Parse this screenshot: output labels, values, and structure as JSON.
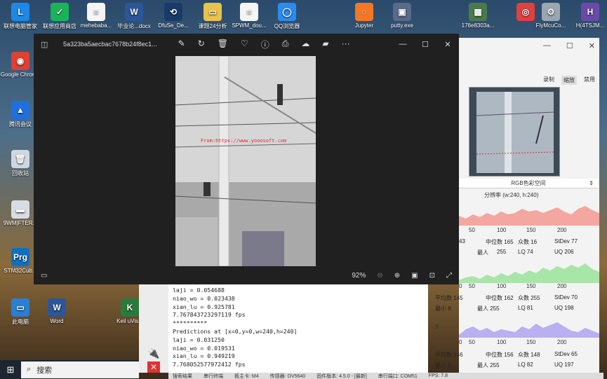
{
  "desktop": {
    "top_icons": [
      {
        "label": "联想电脑管家",
        "icon": "lenovo-icon",
        "color": "#1e88e5",
        "glyph": "L"
      },
      {
        "label": "联想应用商店",
        "icon": "app-store-icon",
        "color": "#19b45a",
        "glyph": "✓"
      },
      {
        "label": "mehebaba...",
        "icon": "document-icon",
        "color": "#f5f5f5",
        "glyph": "≡"
      },
      {
        "label": "毕业论...docx",
        "icon": "word-doc-icon",
        "color": "#2b579a",
        "glyph": "W"
      },
      {
        "label": "DfuSe_De...",
        "icon": "dfuse-icon",
        "color": "#1a3a6a",
        "glyph": "⟲"
      },
      {
        "label": "课题24分析",
        "icon": "folder-icon",
        "color": "#e8c24a",
        "glyph": "▭"
      },
      {
        "label": "SPWM_dou...",
        "icon": "document-icon",
        "color": "#f5f5f5",
        "glyph": "≡"
      },
      {
        "label": "QQ浏览器",
        "icon": "qq-browser-icon",
        "color": "#2a8cf0",
        "glyph": "◯"
      },
      {
        "label": "Jupyter",
        "icon": "jupyter-icon",
        "color": "#f37726",
        "glyph": "◌"
      },
      {
        "label": "putty.exe",
        "icon": "putty-icon",
        "color": "#5a6a8a",
        "glyph": "▣"
      },
      {
        "label": "176e8303a...",
        "icon": "image-file-icon",
        "color": "#4a7a4a",
        "glyph": "▦"
      },
      {
        "label": "",
        "icon": "360-icon",
        "color": "#e04040",
        "glyph": "◎"
      },
      {
        "label": "FlyMcuCo...",
        "icon": "gear-icon",
        "color": "#9aa6b2",
        "glyph": "⚙"
      },
      {
        "label": "H(4TSJM...",
        "icon": "h-file-icon",
        "color": "#6a4aa8",
        "glyph": "H"
      }
    ],
    "left_icons": [
      {
        "label": "Google Chrome",
        "icon": "chrome-icon",
        "color": "#e04030",
        "glyph": "◉"
      },
      {
        "label": "腾讯会议",
        "icon": "tencent-meeting-icon",
        "color": "#1f6fe0",
        "glyph": "▲"
      },
      {
        "label": "回收站",
        "icon": "recycle-bin-icon",
        "color": "#cfd8e0",
        "glyph": "🗑"
      },
      {
        "label": "9WM|FTER...",
        "icon": "file-icon",
        "color": "#d8dde5",
        "glyph": "▬"
      },
      {
        "label": "STM32Cub...",
        "icon": "stm32-prg-icon",
        "color": "#1070c0",
        "glyph": "Prg"
      },
      {
        "label": "此电脑",
        "icon": "this-pc-icon",
        "color": "#2a7fd4",
        "glyph": "▭"
      },
      {
        "label": "Word",
        "icon": "word-icon",
        "color": "#2b579a",
        "glyph": "W"
      },
      {
        "label": "Keil uVis...",
        "icon": "keil-icon",
        "color": "#2a7a3a",
        "glyph": "K"
      }
    ]
  },
  "viewer": {
    "filename": "5a323ba5aecbac7678b24f8ec1...",
    "toolbar_icons": [
      "edit-icon",
      "rotate-icon",
      "delete-icon",
      "favorite-icon",
      "info-icon",
      "print-icon",
      "onedrive-icon",
      "clipchamp-icon",
      "more-icon"
    ],
    "toolbar_glyphs": [
      "✎",
      "↻",
      "🗑",
      "♡",
      "ⓘ",
      "⎙",
      "☁",
      "▰",
      "···"
    ],
    "zoom": "92%",
    "watermark": "From:https://www.yooosoft.com"
  },
  "panel": {
    "tabs": [
      "录制",
      "缩放",
      "禁用"
    ],
    "active_tab": "缩放",
    "color_space": "RGB色彩空间",
    "resolution": "分辨率 (w:240, h:240)",
    "red": {
      "color": "#f4a6a0",
      "axis": [
        "50",
        "100",
        "150",
        "200"
      ],
      "stats": [
        "43",
        "中位数 165",
        "众数 16",
        "StDev 77"
      ],
      "stats2": [
        "最小",
        "255",
        "LQ 74",
        "UQ 206"
      ],
      "stats2_prefix": "最人"
    },
    "green": {
      "color": "#a8e6a8",
      "axis": [
        "0",
        "50",
        "100",
        "150",
        "200"
      ],
      "label": "",
      "stats": [
        "平均数 145",
        "中位数 162",
        "众数 255",
        "StDev 70"
      ],
      "stats2": [
        "最小 8",
        "最人 255",
        "LQ 81",
        "UQ 198"
      ]
    },
    "blue": {
      "color": "#b8b0f0",
      "axis": [
        "0",
        "50",
        "100",
        "150",
        "200"
      ],
      "label": "B",
      "stats": [
        "平均数 146",
        "中位数 156",
        "众数 148",
        "StDev 65"
      ],
      "stats2": [
        "最小 0",
        "最人 255",
        "LQ 82",
        "UQ 197"
      ]
    }
  },
  "console": {
    "lines": [
      "laji = 0.054688",
      "niao_wo = 0.023438",
      "xian_lu = 0.925781",
      "7.767843723297119 fps",
      "**********",
      "Predictions at [x=0,y=0,w=240,h=240]",
      "laji = 0.031250",
      "niao_wo = 0.019531",
      "xian_lu = 0.949219",
      "7.768052577972412 fps"
    ]
  },
  "statusbar": {
    "items": [
      "搜索结果",
      "串行终端",
      "板主卡: M4",
      "传感器: OV5640",
      "固件版本: 4.5.0 - [最新]",
      "串行端口: COM51",
      "FPS: 7.8"
    ]
  },
  "taskbar": {
    "search_placeholder": "搜索"
  }
}
